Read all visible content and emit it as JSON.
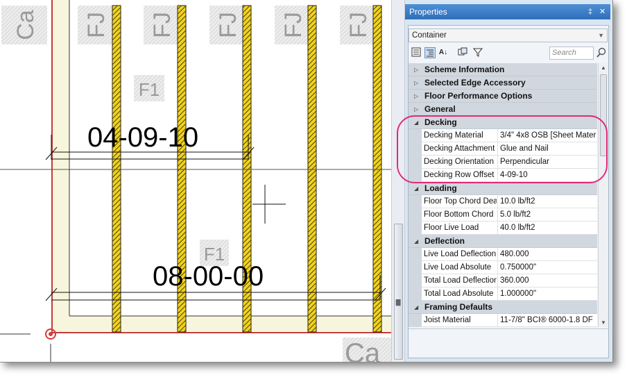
{
  "canvas": {
    "tags_top": [
      "Ca",
      "FJ",
      "FJ",
      "FJ",
      "FJ",
      "FJ"
    ],
    "tag_bottom": "Ca",
    "region_tag_1": "F1",
    "region_tag_2": "F1",
    "dimension_1": "04-09-10",
    "dimension_2": "08-00-00"
  },
  "panel": {
    "title": "Properties",
    "pin_glyph": "‡",
    "close_glyph": "✕",
    "selector_value": "Container",
    "search_placeholder": "Search",
    "categories": [
      {
        "name": "Scheme Information",
        "expanded": false,
        "props": []
      },
      {
        "name": "Selected Edge Accessory",
        "expanded": false,
        "props": []
      },
      {
        "name": "Floor Performance Options",
        "expanded": false,
        "props": []
      },
      {
        "name": "General",
        "expanded": false,
        "props": []
      },
      {
        "name": "Decking",
        "expanded": true,
        "props": [
          {
            "name": "Decking Material",
            "value": "3/4\" 4x8 OSB [Sheet Mater"
          },
          {
            "name": "Decking Attachment",
            "value": "Glue and Nail"
          },
          {
            "name": "Decking Orientation",
            "value": "Perpendicular"
          },
          {
            "name": "Decking Row Offset",
            "value": "4-09-10"
          }
        ]
      },
      {
        "name": "Loading",
        "expanded": true,
        "props": [
          {
            "name": "Floor Top Chord Dead",
            "value": "10.0 lb/ft2"
          },
          {
            "name": "Floor Bottom Chord",
            "value": "5.0 lb/ft2"
          },
          {
            "name": "Floor Live Load",
            "value": "40.0 lb/ft2"
          }
        ]
      },
      {
        "name": "Deflection",
        "expanded": true,
        "props": [
          {
            "name": "Live Load Deflection",
            "value": "480.000"
          },
          {
            "name": "Live Load Absolute",
            "value": "0.750000\""
          },
          {
            "name": "Total Load Deflection",
            "value": "360.000"
          },
          {
            "name": "Total Load Absolute",
            "value": "1.000000\""
          }
        ]
      },
      {
        "name": "Framing Defaults",
        "expanded": true,
        "props": [
          {
            "name": "Joist Material",
            "value": "11-7/8\" BCI® 6000-1.8 DF"
          }
        ]
      }
    ]
  },
  "colors": {
    "joist_yellow": "#f2d21a",
    "highlight": "#e0297a",
    "title_bar": "#3a7cc8",
    "category_bg": "#d1d7de"
  }
}
